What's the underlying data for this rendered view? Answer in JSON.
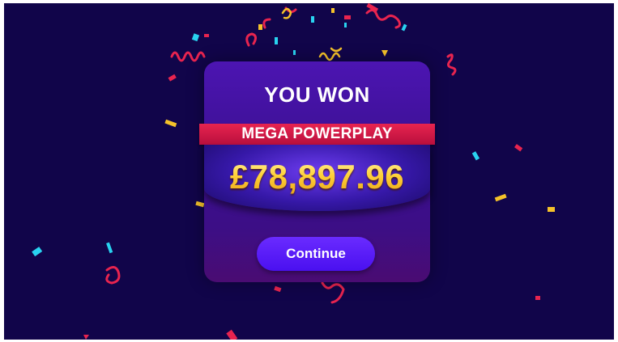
{
  "dialog": {
    "title": "YOU WON",
    "prize_name": "MEGA POWERPLAY",
    "amount": "£78,897.96",
    "continue_label": "Continue"
  },
  "colors": {
    "background": "#11054a",
    "ribbon": "#e8244f",
    "amount_gold": "#ffd33a",
    "button": "#5a1cf8",
    "confetti": [
      "#e8244f",
      "#29d3f0",
      "#f5c22a"
    ]
  }
}
